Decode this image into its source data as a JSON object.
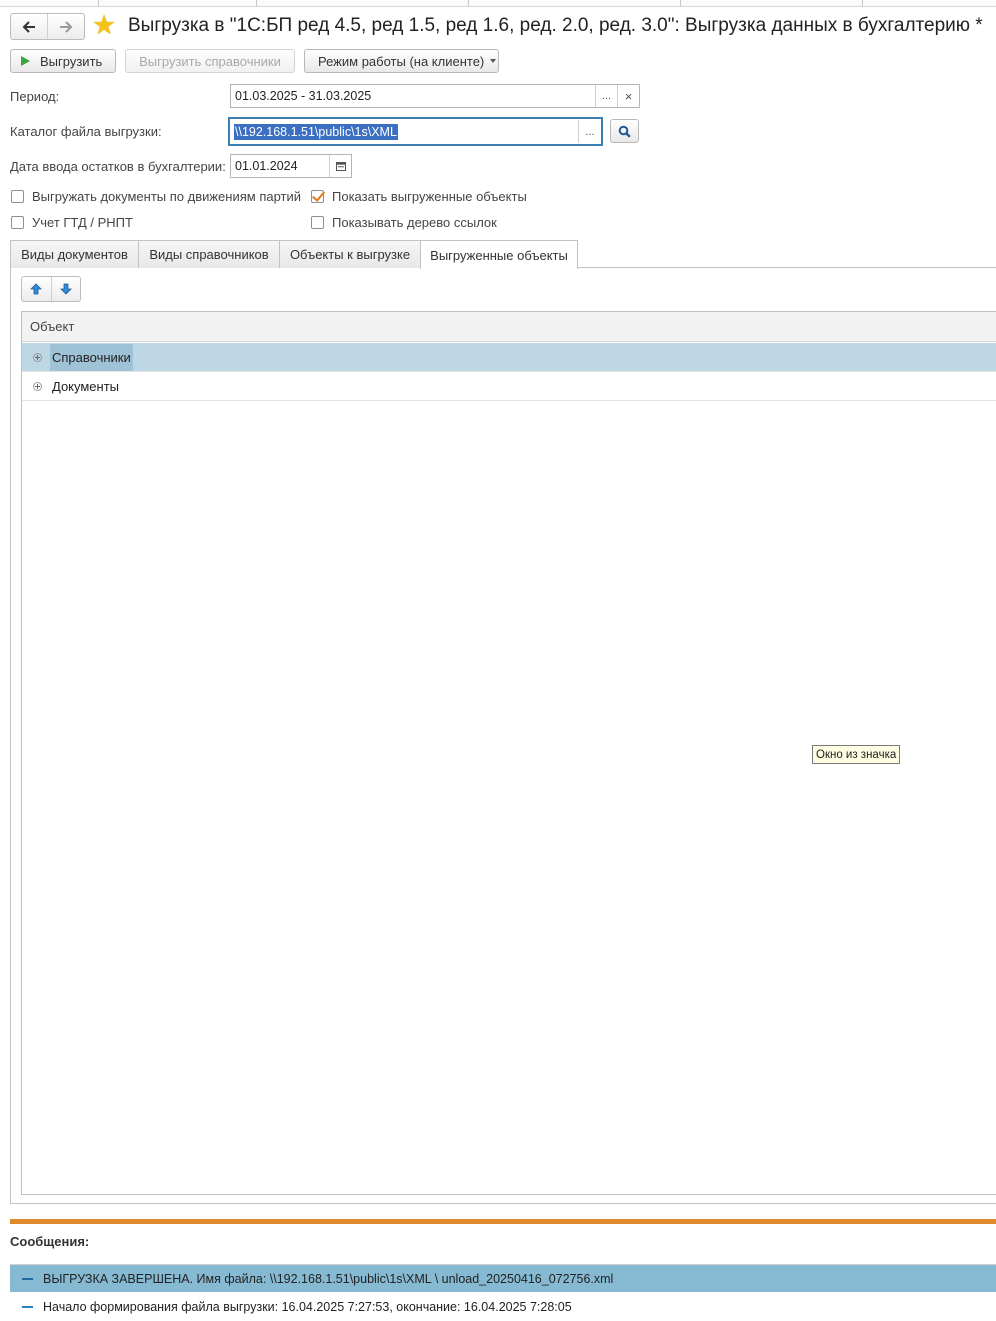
{
  "header": {
    "back_icon": "arrow-left-icon",
    "forward_icon": "arrow-right-icon",
    "favorite_icon": "star-icon",
    "title": "Выгрузка  в \"1С:БП ред 4.5, ред 1.5, ред 1.6, ред. 2.0, ред. 3.0\": Выгрузка данных в бухгалтерию *"
  },
  "toolbar": {
    "export_label": "Выгрузить",
    "export_refs_label": "Выгрузить справочники",
    "mode_label": "Режим работы (на клиенте)"
  },
  "form": {
    "period_label": "Период:",
    "period_value": "01.03.2025 - 31.03.2025",
    "period_select": "...",
    "period_clear": "×",
    "folder_label": "Каталог файла выгрузки:",
    "folder_value": "\\\\192.168.1.51\\public\\1s\\XML",
    "folder_select": "...",
    "balance_date_label": "Дата ввода остатков в бухгалтерии:",
    "balance_date_value": "01.01.2024",
    "checkboxes": [
      {
        "label": "Выгружать документы по движениям партий",
        "checked": false
      },
      {
        "label": "Показать выгруженные объекты",
        "checked": true
      },
      {
        "label": "Учет ГТД / РНПТ",
        "checked": false
      },
      {
        "label": "Показывать дерево ссылок",
        "checked": false
      }
    ]
  },
  "tabs": [
    {
      "label": "Виды документов",
      "active": false
    },
    {
      "label": "Виды справочников",
      "active": false
    },
    {
      "label": "Объекты к выгрузке",
      "active": false
    },
    {
      "label": "Выгруженные объекты",
      "active": true
    }
  ],
  "table": {
    "column_header": "Объект",
    "rows": [
      {
        "label": "Справочники",
        "selected": true
      },
      {
        "label": "Документы",
        "selected": false
      }
    ]
  },
  "tooltip": "Окно из значка",
  "messages": {
    "label": "Сообщения:",
    "items": [
      "ВЫГРУЗКА ЗАВЕРШЕНА. Имя файла: \\\\192.168.1.51\\public\\1s\\XML \\ unload_20250416_072756.xml",
      "Начало формирования файла выгрузки: 16.04.2025 7:27:53, окончание: 16.04.2025 7:28:05"
    ]
  },
  "colors": {
    "accent": "#e08a2e",
    "selection": "#bdd7e5",
    "message_selection": "#86b9d2",
    "star": "#f3c318"
  }
}
